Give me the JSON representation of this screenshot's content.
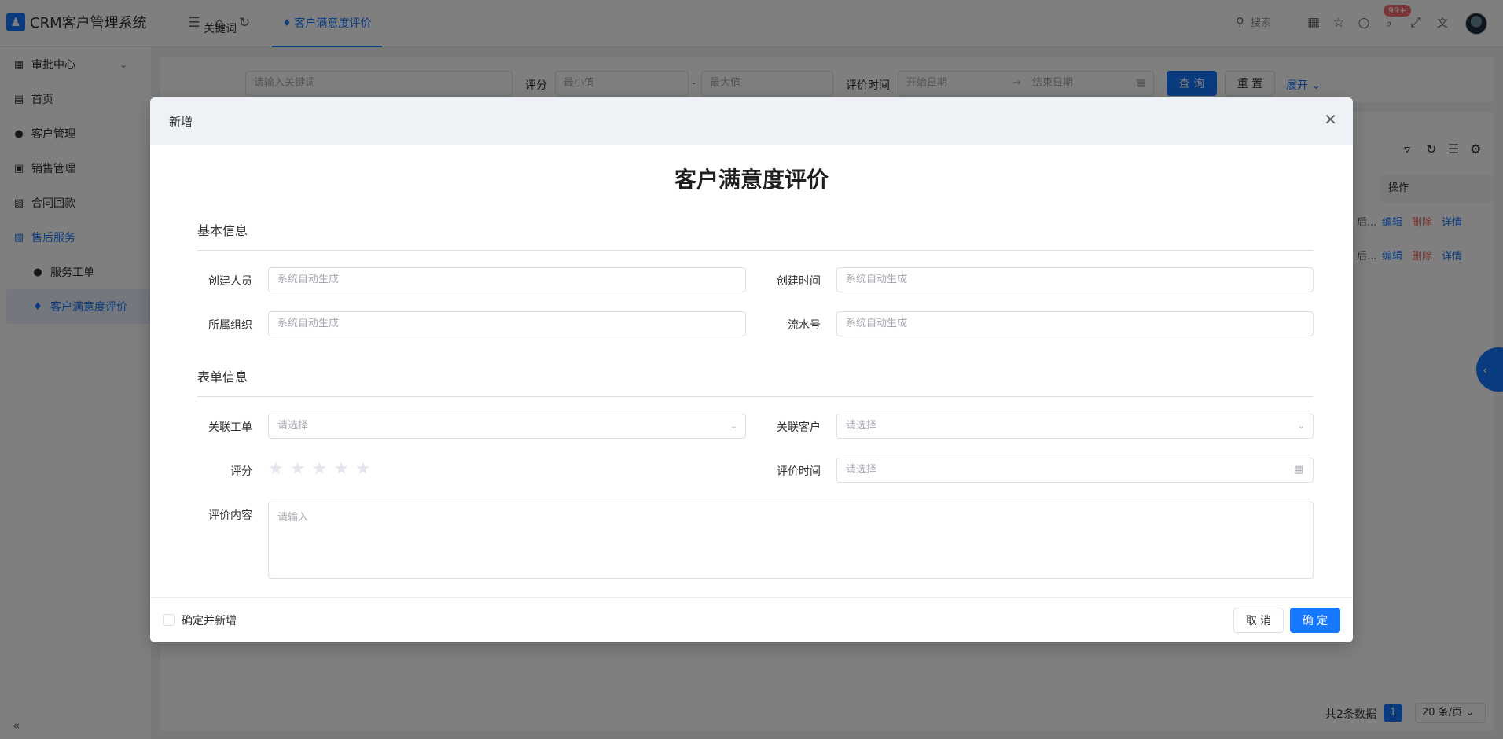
{
  "header": {
    "app_title": "CRM客户管理系统",
    "active_tab": "客户满意度评价",
    "search_placeholder": "搜索",
    "notification_badge": "99+",
    "icons": [
      "menu-icon",
      "home-icon",
      "refresh-icon",
      "grid-icon",
      "star-icon",
      "message-icon",
      "bell-icon",
      "fullscreen-icon",
      "translate-icon"
    ]
  },
  "sidebar": {
    "items": [
      {
        "label": "审批中心",
        "icon": "approval-icon"
      },
      {
        "label": "首页",
        "icon": "home-icon"
      },
      {
        "label": "客户管理",
        "icon": "user-icon"
      },
      {
        "label": "销售管理",
        "icon": "sales-icon"
      },
      {
        "label": "合同回款",
        "icon": "contract-icon"
      },
      {
        "label": "售后服务",
        "icon": "service-icon"
      },
      {
        "label": "服务工单",
        "icon": "user-icon"
      },
      {
        "label": "客户满意度评价",
        "icon": "rating-icon"
      }
    ]
  },
  "filters": {
    "keyword_label": "关键词",
    "keyword_placeholder": "请输入关键词",
    "score_label": "评分",
    "score_min_placeholder": "最小值",
    "score_separator": "-",
    "score_max_placeholder": "最大值",
    "time_label": "评价时间",
    "start_placeholder": "开始日期",
    "range_arrow": "→",
    "end_placeholder": "结束日期",
    "query_button": "查 询",
    "reset_button": "重 置",
    "expand_link": "展开"
  },
  "table": {
    "op_header": "操作",
    "rows": [
      {
        "trunc": "后...",
        "edit": "编辑",
        "delete": "删除",
        "detail": "详情"
      },
      {
        "trunc": "后...",
        "edit": "编辑",
        "delete": "删除",
        "detail": "详情"
      }
    ],
    "total_text": "共2条数据",
    "current_page": "1",
    "page_size": "20 条/页"
  },
  "modal": {
    "title": "新增",
    "form_title": "客户满意度评价",
    "basic_section": "基本信息",
    "form_section": "表单信息",
    "fields": {
      "creator_label": "创建人员",
      "creator_placeholder": "系统自动生成",
      "created_time_label": "创建时间",
      "created_time_placeholder": "系统自动生成",
      "org_label": "所属组织",
      "org_placeholder": "系统自动生成",
      "serial_label": "流水号",
      "serial_placeholder": "系统自动生成",
      "ticket_label": "关联工单",
      "ticket_placeholder": "请选择",
      "customer_label": "关联客户",
      "customer_placeholder": "请选择",
      "score_label": "评分",
      "score_value": 0,
      "score_max": 5,
      "eval_time_label": "评价时间",
      "eval_time_placeholder": "请选择",
      "content_label": "评价内容",
      "content_placeholder": "请输入"
    },
    "footer": {
      "confirm_add_label": "确定并新增",
      "cancel_button": "取 消",
      "confirm_button": "确 定"
    }
  },
  "colors": {
    "primary": "#1677ff",
    "danger": "#f56c6c",
    "mask": "rgba(0,0,0,0.5)"
  }
}
